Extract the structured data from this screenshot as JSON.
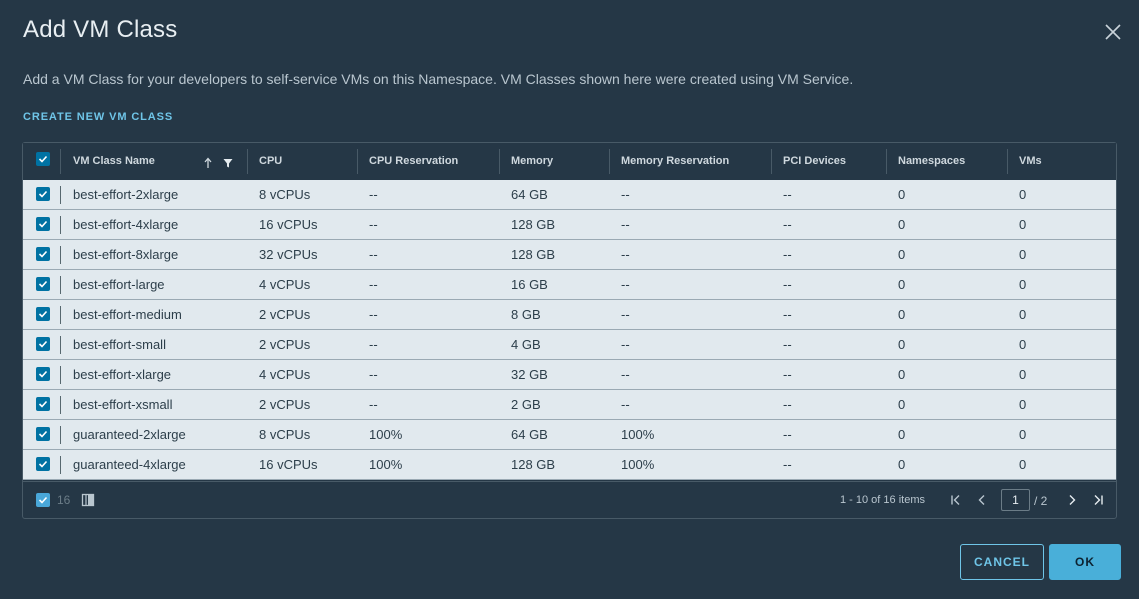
{
  "modal": {
    "title": "Add VM Class",
    "description": "Add a VM Class for your developers to self-service VMs on this Namespace. VM Classes shown here were created using VM Service.",
    "create_link": "CREATE NEW VM CLASS"
  },
  "icons": {
    "close": "close-icon",
    "sort": "sort-ascending-icon",
    "filter": "filter-icon",
    "checkbox": "check-icon",
    "column_toggle": "column-toggle-icon",
    "first": "first-page-icon",
    "prev": "previous-page-icon",
    "next": "next-page-icon",
    "last": "last-page-icon"
  },
  "table": {
    "headers": [
      "VM Class Name",
      "CPU",
      "CPU Reservation",
      "Memory",
      "Memory Reservation",
      "PCI Devices",
      "Namespaces",
      "VMs"
    ],
    "rows": [
      [
        "best-effort-2xlarge",
        "8 vCPUs",
        "--",
        "64 GB",
        "--",
        "--",
        "0",
        "0"
      ],
      [
        "best-effort-4xlarge",
        "16 vCPUs",
        "--",
        "128 GB",
        "--",
        "--",
        "0",
        "0"
      ],
      [
        "best-effort-8xlarge",
        "32 vCPUs",
        "--",
        "128 GB",
        "--",
        "--",
        "0",
        "0"
      ],
      [
        "best-effort-large",
        "4 vCPUs",
        "--",
        "16 GB",
        "--",
        "--",
        "0",
        "0"
      ],
      [
        "best-effort-medium",
        "2 vCPUs",
        "--",
        "8 GB",
        "--",
        "--",
        "0",
        "0"
      ],
      [
        "best-effort-small",
        "2 vCPUs",
        "--",
        "4 GB",
        "--",
        "--",
        "0",
        "0"
      ],
      [
        "best-effort-xlarge",
        "4 vCPUs",
        "--",
        "32 GB",
        "--",
        "--",
        "0",
        "0"
      ],
      [
        "best-effort-xsmall",
        "2 vCPUs",
        "--",
        "2 GB",
        "--",
        "--",
        "0",
        "0"
      ],
      [
        "guaranteed-2xlarge",
        "8 vCPUs",
        "100%",
        "64 GB",
        "100%",
        "--",
        "0",
        "0"
      ],
      [
        "guaranteed-4xlarge",
        "16 vCPUs",
        "100%",
        "128 GB",
        "100%",
        "--",
        "0",
        "0"
      ]
    ],
    "selected_count": "16"
  },
  "pagination": {
    "summary": "1 - 10 of 16 items",
    "current_page": "1",
    "total": "/ 2"
  },
  "buttons": {
    "cancel": "CANCEL",
    "ok": "OK"
  },
  "colors": {
    "background": "#253746",
    "row_bg": "#e1e9ee",
    "checkbox": "#0072a3",
    "link": "#6fc5e8",
    "primary": "#49afd9"
  }
}
